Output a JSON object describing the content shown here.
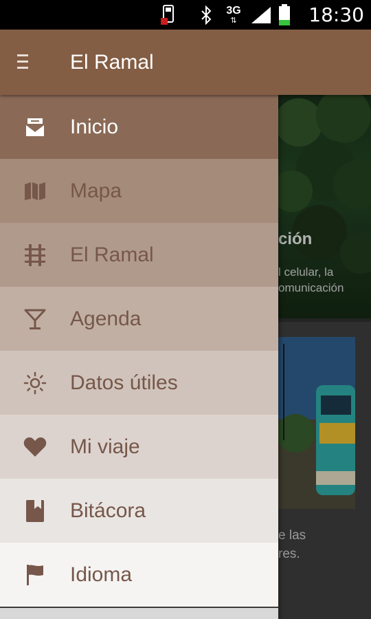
{
  "status_bar": {
    "time": "18:30",
    "network": "3G",
    "icons": [
      "sim-card-icon",
      "bluetooth-icon",
      "3g-icon",
      "signal-icon",
      "battery-icon"
    ]
  },
  "app_bar": {
    "title": "El Ramal",
    "menu_icon": "hamburger-menu-icon",
    "color": "#835d44"
  },
  "drawer": {
    "items": [
      {
        "label": "Inicio",
        "icon": "home-icon",
        "bg": "#8a6a57",
        "fg": "#ffffff",
        "selected": true
      },
      {
        "label": "Mapa",
        "icon": "map-icon",
        "bg": "#a58b7a",
        "fg": "#76574a"
      },
      {
        "label": "El Ramal",
        "icon": "rail-track-icon",
        "bg": "#b09a8c",
        "fg": "#76574a"
      },
      {
        "label": "Agenda",
        "icon": "cocktail-icon",
        "bg": "#c1afa4",
        "fg": "#76574a"
      },
      {
        "label": "Datos útiles",
        "icon": "sun-icon",
        "bg": "#d0c3bb",
        "fg": "#76574a"
      },
      {
        "label": "Mi viaje",
        "icon": "heart-icon",
        "bg": "#ddd3ce",
        "fg": "#76574a"
      },
      {
        "label": "Bitácora",
        "icon": "bookmark-book-icon",
        "bg": "#e9e5e2",
        "fg": "#76574a"
      },
      {
        "label": "Idioma",
        "icon": "flag-icon",
        "bg": "#f6f4f3",
        "fg": "#76574a"
      }
    ]
  },
  "background": {
    "card1_title": "ción",
    "card1_text": "l celular, la\nomunicación",
    "card2_text": "e las\nres."
  }
}
